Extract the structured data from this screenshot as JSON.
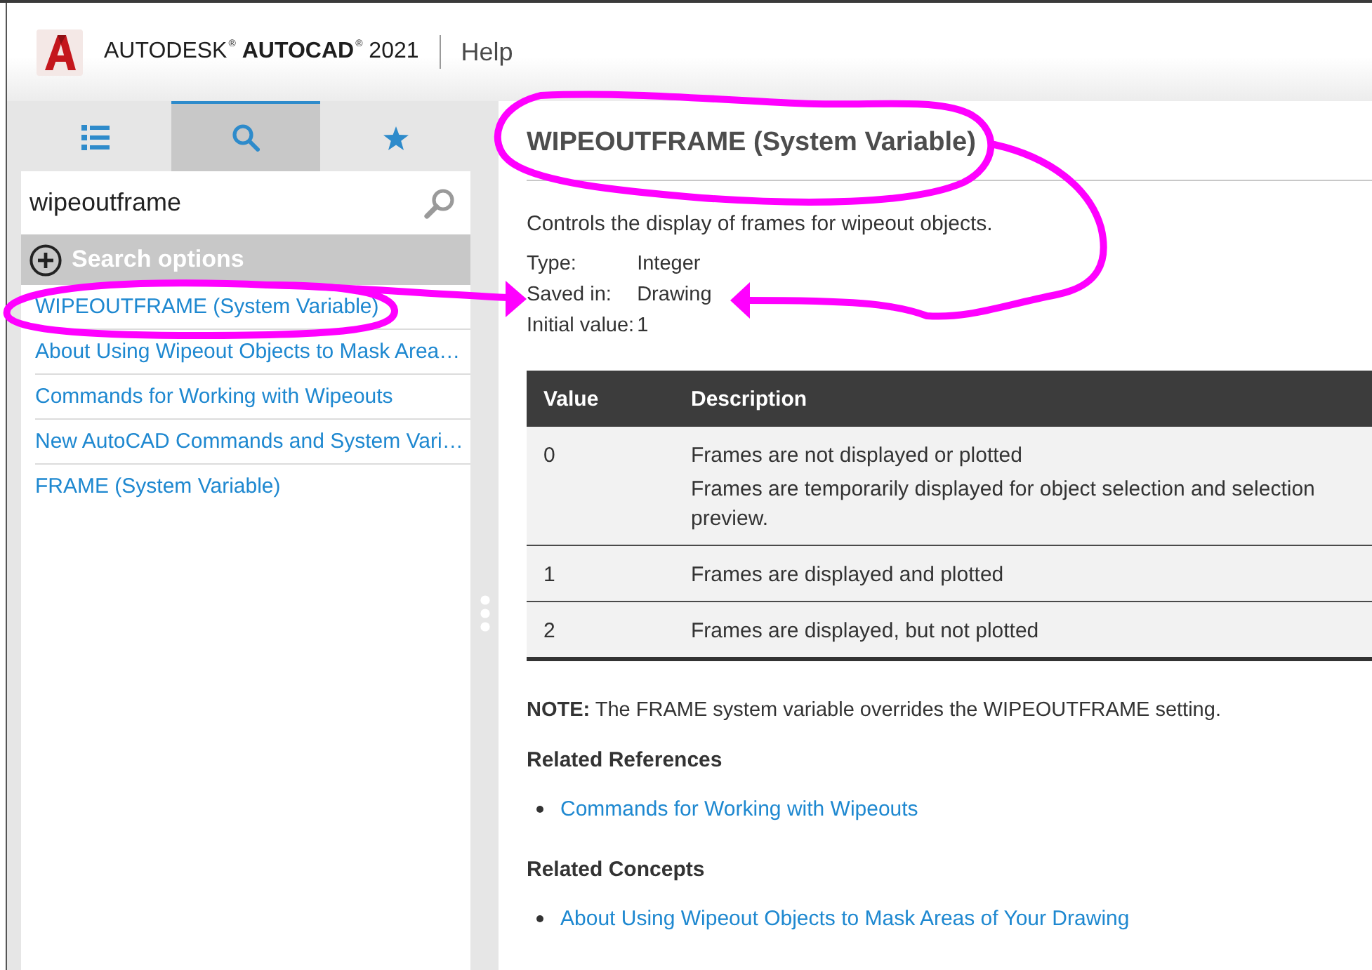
{
  "header": {
    "brand": "AUTODESK$^{®}$ **AUTOCAD**$^{®}$ 2021",
    "section": "Help"
  },
  "sidebar": {
    "tabs": [
      {
        "kind": "contents",
        "selected": false
      },
      {
        "kind": "search",
        "selected": true
      },
      {
        "kind": "favorites",
        "selected": false
      }
    ],
    "search": {
      "value": "wipeoutframe"
    },
    "search_options": {
      "label": "Search options",
      "expanded": false
    },
    "results": [
      "WIPEOUTFRAME (System Variable)",
      "About Using Wipeout Objects to Mask Area…",
      "Commands for Working with Wipeouts",
      "New AutoCAD Commands and System Vari…",
      "FRAME (System Variable)"
    ]
  },
  "article": {
    "title": "WIPEOUTFRAME (System Variable)",
    "description": "Controls the display of frames for wipeout objects.",
    "properties": [
      {
        "label": "Type:",
        "value": "Integer"
      },
      {
        "label": "Saved in:",
        "value": "Drawing"
      },
      {
        "label": "Initial value:",
        "value": "1"
      }
    ],
    "table": {
      "columns": [
        "Value",
        "Description"
      ],
      "rows": [
        {
          "value": "0",
          "description": [
            "Frames are not displayed or plotted",
            "Frames are temporarily displayed for object selection and selection preview."
          ]
        },
        {
          "value": "1",
          "description": [
            "Frames are displayed and plotted"
          ]
        },
        {
          "value": "2",
          "description": [
            "Frames are displayed, but not plotted"
          ]
        }
      ]
    },
    "note": "**NOTE:** The FRAME system variable overrides the WIPEOUTFRAME setting.",
    "sections": [
      {
        "heading": "Related References",
        "links": [
          "Commands for Working with Wipeouts"
        ]
      },
      {
        "heading": "Related Concepts",
        "links": [
          "About Using Wipeout Objects to Mask Areas of Your Drawing"
        ]
      }
    ]
  }
}
